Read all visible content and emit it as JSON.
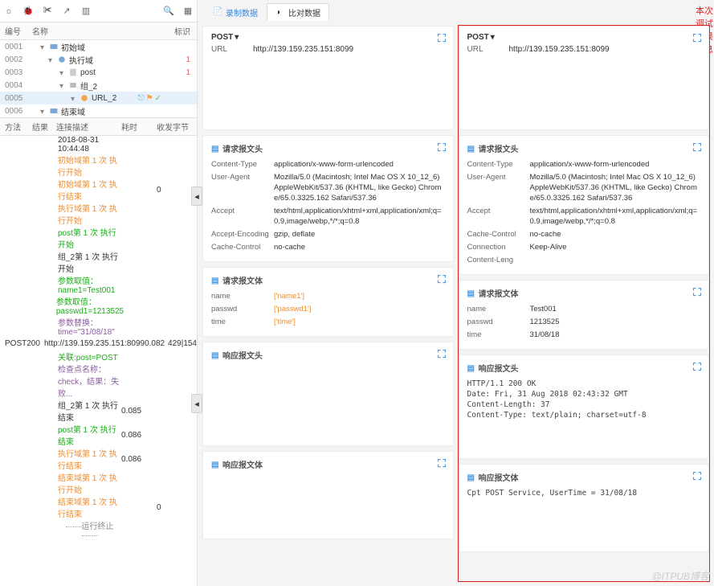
{
  "toolbar": {
    "icons": [
      "gear-icon",
      "bug-icon",
      "scissors-icon",
      "share-icon",
      "layers-icon"
    ],
    "right_icons": [
      "search-icon",
      "filter-icon"
    ]
  },
  "tree": {
    "header": {
      "id": "编号",
      "name": "名称",
      "mark": "标识"
    },
    "rows": [
      {
        "id": "0001",
        "indent": 10,
        "icon": "folder-start",
        "label": "初始域",
        "mark": "",
        "selected": false
      },
      {
        "id": "0002",
        "indent": 20,
        "icon": "folder-exec",
        "label": "执行域",
        "mark": "1",
        "selected": false
      },
      {
        "id": "0003",
        "indent": 34,
        "icon": "page",
        "label": "post",
        "mark": "1",
        "selected": false
      },
      {
        "id": "0004",
        "indent": 34,
        "icon": "group",
        "label": "组_2",
        "mark": "",
        "selected": false
      },
      {
        "id": "0005",
        "indent": 48,
        "icon": "url",
        "label": "URL_2",
        "mark": "",
        "selected": true,
        "row_icons": true
      },
      {
        "id": "0006",
        "indent": 10,
        "icon": "folder-end",
        "label": "结束域",
        "mark": "",
        "selected": false
      }
    ]
  },
  "log": {
    "header": {
      "c1": "方法",
      "c2": "结果",
      "c3": "连接描述",
      "c4": "耗时",
      "c5": "收发字节"
    },
    "rows": [
      {
        "c3": "2018-08-31 10:44:48",
        "cls": ""
      },
      {
        "c3": "初始域第 1 次 执行开始",
        "cls": "orange"
      },
      {
        "c3": "初始域第 1 次 执行结束",
        "c4": "",
        "c5": "0",
        "cls": "orange"
      },
      {
        "c3": "执行域第 1 次 执行开始",
        "cls": "orange"
      },
      {
        "c3": "post第 1 次 执行开始",
        "cls": "green"
      },
      {
        "c3": "组_2第 1 次 执行开始",
        "cls": ""
      },
      {
        "c3": "参数取值：name1=Test001",
        "cls": "green"
      },
      {
        "c3": "参数取值：passwd1=1213525",
        "cls": "green"
      },
      {
        "c3": "参数替换：time=\"31/08/18\"",
        "cls": "purple"
      },
      {
        "c1": "POST",
        "c2": "200",
        "c3": "http://139.159.235.151:8099",
        "c4": "0.082",
        "c5": "429|154",
        "cls": ""
      },
      {
        "c3": "关联:post=POST",
        "cls": "green"
      },
      {
        "c3": "检查点名称：check，结果：失败...",
        "cls": "purple"
      },
      {
        "c3": "组_2第 1 次 执行结束",
        "c4": "0.085",
        "cls": ""
      },
      {
        "c3": "post第 1 次 执行结束",
        "c4": "0.086",
        "cls": "green"
      },
      {
        "c3": "执行域第 1 次 执行结束",
        "c4": "0.086",
        "cls": "orange"
      },
      {
        "c3": "结束域第 1 次 执行开始",
        "cls": "orange"
      },
      {
        "c3": "结束域第 1 次 执行结束",
        "c5": "0",
        "cls": "orange"
      },
      {
        "c3": "运行终止",
        "cls": "gray",
        "rule": true
      }
    ]
  },
  "tabs": {
    "items": [
      {
        "label": "录制数据",
        "active": false
      },
      {
        "label": "比对数据",
        "active": true
      }
    ]
  },
  "result_label": "本次调试结果信息",
  "left_col": {
    "request": {
      "method": "POST",
      "url_label": "URL",
      "url": "http://139.159.235.151:8099"
    },
    "req_header": {
      "title": "请求报文头",
      "rows": [
        {
          "k": "Content-Type",
          "v": "application/x-www-form-urlencoded"
        },
        {
          "k": "User-Agent",
          "v": "Mozilla/5.0 (Macintosh; Intel Mac OS X 10_12_6) AppleWebKit/537.36 (KHTML, like Gecko) Chrome/65.0.3325.162 Safari/537.36"
        },
        {
          "k": "Accept",
          "v": "text/html,application/xhtml+xml,application/xml;q=0.9,image/webp,*/*;q=0.8"
        },
        {
          "k": "Accept-Encoding",
          "v": "gzip, deflate"
        },
        {
          "k": "Cache-Control",
          "v": "no-cache"
        }
      ]
    },
    "req_body": {
      "title": "请求报文体",
      "rows": [
        {
          "k": "name",
          "v": "['name1']",
          "var": true
        },
        {
          "k": "passwd",
          "v": "['passwd1']",
          "var": true
        },
        {
          "k": "time",
          "v": "['time']",
          "var": true
        }
      ]
    },
    "resp_header": {
      "title": "响应报文头",
      "text": ""
    },
    "resp_body": {
      "title": "响应报文体",
      "text": ""
    }
  },
  "right_col": {
    "request": {
      "method": "POST",
      "url_label": "URL",
      "url": "http://139.159.235.151:8099"
    },
    "req_header": {
      "title": "请求报文头",
      "rows": [
        {
          "k": "Content-Type",
          "v": "application/x-www-form-urlencoded"
        },
        {
          "k": "User-Agent",
          "v": "Mozilla/5.0 (Macintosh; Intel Mac OS X 10_12_6) AppleWebKit/537.36 (KHTML, like Gecko) Chrome/65.0.3325.162 Safari/537.36"
        },
        {
          "k": "Accept",
          "v": "text/html,application/xhtml+xml,application/xml;q=0.9,image/webp,*/*;q=0.8"
        },
        {
          "k": "Cache-Control",
          "v": "no-cache"
        },
        {
          "k": "Connection",
          "v": "Keep-Alive"
        },
        {
          "k": "Content-Leng",
          "v": ""
        }
      ]
    },
    "req_body": {
      "title": "请求报文体",
      "rows": [
        {
          "k": "name",
          "v": "Test001"
        },
        {
          "k": "passwd",
          "v": "1213525"
        },
        {
          "k": "time",
          "v": "31/08/18"
        }
      ]
    },
    "resp_header": {
      "title": "响应报文头",
      "text": "HTTP/1.1 200 OK\nDate: Fri, 31 Aug 2018 02:43:32 GMT\nContent-Length: 37\nContent-Type: text/plain; charset=utf-8"
    },
    "resp_body": {
      "title": "响应报文体",
      "text": "Cpt POST Service, UserTime = 31/08/18"
    }
  },
  "watermark": "@ITPUB博客"
}
